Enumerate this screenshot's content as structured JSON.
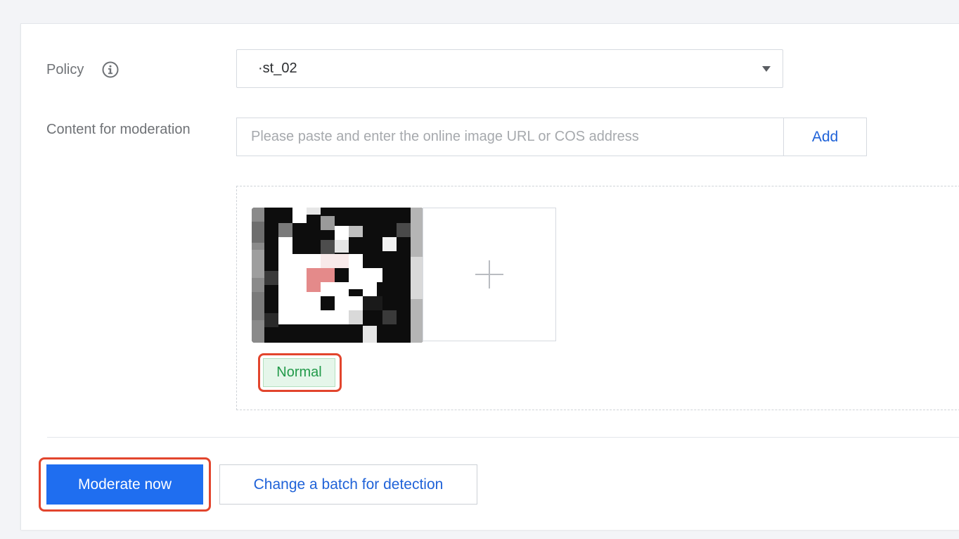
{
  "form": {
    "policy_label": "Policy",
    "policy_info_icon": "info-circle-icon",
    "policy_value": "·st_02",
    "content_label": "Content for moderation",
    "url_placeholder": "Please paste and enter the online image URL or COS address",
    "add_label": "Add",
    "add_tile_icon": "plus-icon",
    "result_tag": "Normal"
  },
  "actions": {
    "moderate_label": "Moderate now",
    "change_batch_label": "Change a batch for detection"
  },
  "colors": {
    "primary": "#1f6ef0",
    "link": "#1f62d8",
    "success": "#229a4a",
    "highlight_border": "#e2452d"
  }
}
